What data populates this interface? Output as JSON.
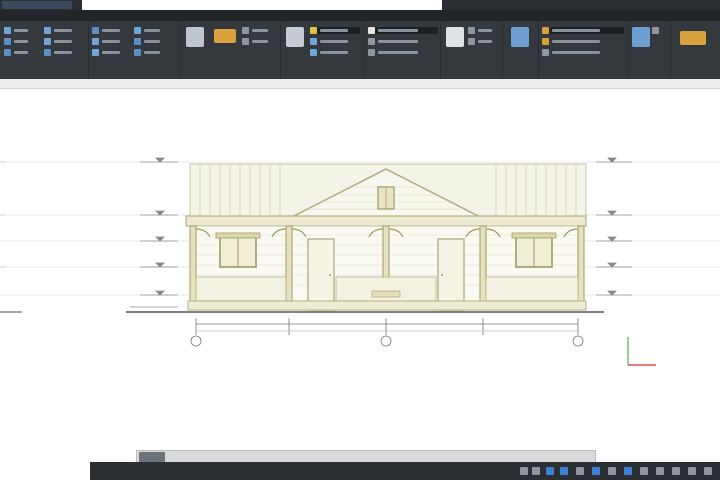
{
  "titlebar": {
    "app_label": "",
    "document_tab": ""
  },
  "menu": {
    "items": [
      "",
      "",
      "",
      "",
      "",
      "",
      "",
      "",
      "",
      "",
      "",
      "",
      "",
      "",
      ""
    ]
  },
  "ribbon": {
    "groups": [
      {
        "label": ""
      },
      {
        "label": ""
      },
      {
        "label": ""
      },
      {
        "label": ""
      },
      {
        "label": ""
      },
      {
        "label": ""
      },
      {
        "label": ""
      },
      {
        "label": ""
      },
      {
        "label": ""
      },
      {
        "label": ""
      }
    ]
  },
  "document": {
    "tab_label": ""
  },
  "drawing": {
    "elevation_labels_left": [
      "",
      "",
      "",
      "",
      "",
      ""
    ],
    "elevation_labels_right": [
      "",
      "",
      "",
      "",
      "",
      ""
    ],
    "dimension_labels": [
      "",
      "",
      "",
      ""
    ],
    "grid_markers": [
      "",
      "",
      ""
    ]
  },
  "command_line": {
    "placeholder": ""
  },
  "statusbar": {
    "coords": ""
  },
  "colors": {
    "drawing_line": "#c8c49a",
    "drawing_dark": "#9f9a66",
    "ribbon_bg": "#35393d",
    "titlebar_bg": "#2b2f34"
  }
}
